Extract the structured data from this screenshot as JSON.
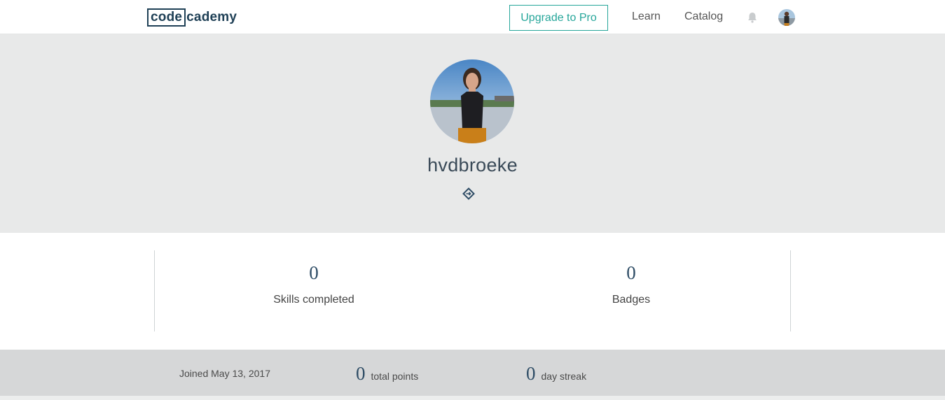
{
  "nav": {
    "logo_box": "code",
    "logo_rest": "cademy",
    "upgrade_label": "Upgrade to Pro",
    "learn_label": "Learn",
    "catalog_label": "Catalog",
    "bell_icon": "bell-icon",
    "avatar_icon": "user-avatar"
  },
  "profile": {
    "username": "hvdbroeke",
    "share_icon": "share-link-icon"
  },
  "stats": [
    {
      "value": "0",
      "label": "Skills completed"
    },
    {
      "value": "0",
      "label": "Badges"
    }
  ],
  "summary": {
    "joined": "Joined May 13, 2017",
    "total_points": "0",
    "total_points_label": "total points",
    "day_streak": "0",
    "day_streak_label": "day streak"
  },
  "colors": {
    "brand": "#1f4056",
    "accent": "#26a69a",
    "hero_bg": "#e8e9e9",
    "band_bg": "#d6d7d8"
  }
}
